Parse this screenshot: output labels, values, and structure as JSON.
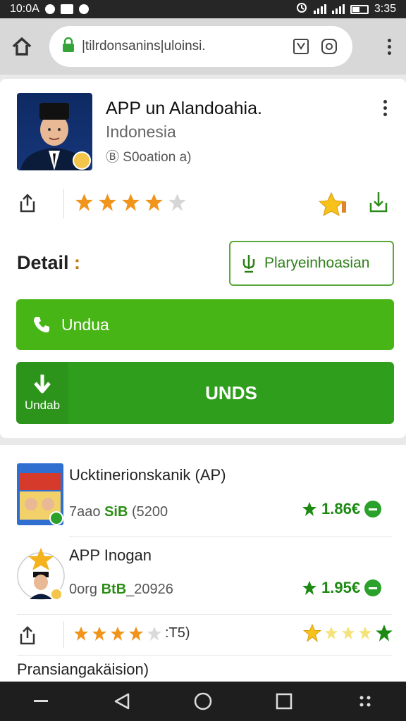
{
  "status_bar": {
    "time_left": "10:0A",
    "time_right": "3:35"
  },
  "browser": {
    "url": "|tilrdonsanins|uloinsi.",
    "icons": [
      "home-icon",
      "lock-icon",
      "download-icon",
      "tab-switcher-icon",
      "more-menu-icon"
    ]
  },
  "app": {
    "title": "APP un Alandoahia.",
    "subtitle": "Indonesia",
    "meta": "Ⓑ S0oation a)",
    "rating": 4,
    "rating_max": 5,
    "detail_label": "Detail",
    "detail_colon": ":",
    "play_button_label": "Plaryeinhoasian",
    "call_button_label": "Undua",
    "download_small_label": "Undab",
    "download_button_label": "UNDS"
  },
  "list": {
    "items": [
      {
        "title": "Ucktinerionskanik (AP)",
        "sub_prefix": "7aao ",
        "sub_highlight": "SiB",
        "sub_suffix": " (5200",
        "price": "1.86€"
      },
      {
        "title": "APP Inogan",
        "sub_prefix": "0org ",
        "sub_highlight": "BtB",
        "sub_suffix": "_20926",
        "price": "1.95€"
      }
    ],
    "rating_text": ":T5)",
    "footer": "Pransiangakäision)"
  },
  "colors": {
    "accent_green": "#48b516",
    "dark_green": "#2f9e1c",
    "star_orange": "#f0941c"
  }
}
